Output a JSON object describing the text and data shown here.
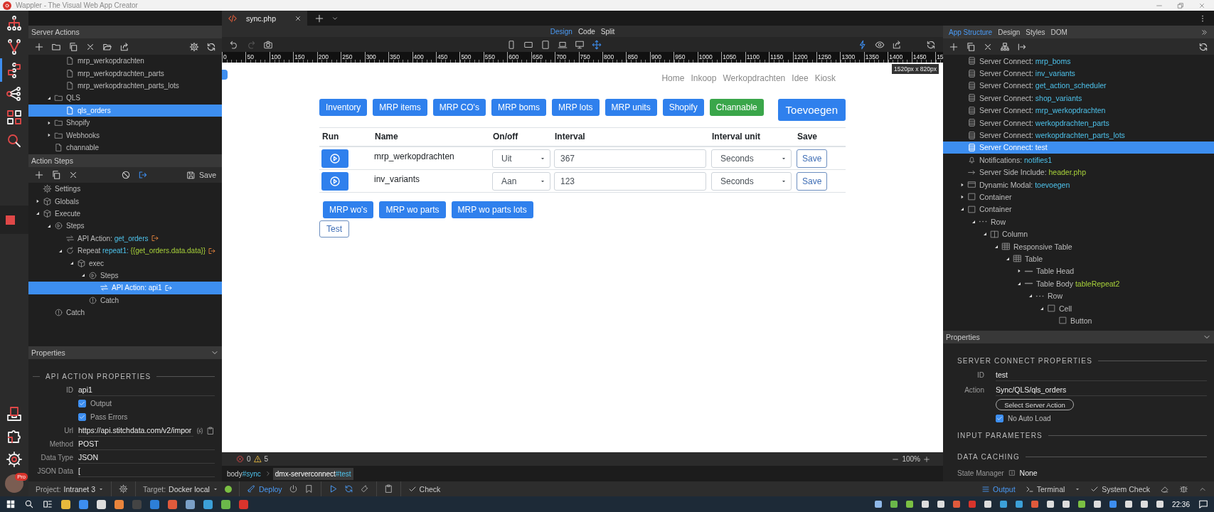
{
  "window": {
    "title": "Wappler - The Visual Web App Creator"
  },
  "rail": {
    "items": [
      {
        "kind": "structure",
        "selected": false
      },
      {
        "kind": "branch",
        "selected": false
      },
      {
        "kind": "flow",
        "selected": true
      },
      {
        "kind": "share",
        "selected": false
      },
      {
        "kind": "grid",
        "selected": false
      },
      {
        "kind": "search",
        "selected": false
      }
    ],
    "badge": "Pro"
  },
  "server_actions": {
    "title": "Server Actions",
    "tree": [
      {
        "children": [
          {
            "label": "mrp_werkopdrachten",
            "kind": "file",
            "selected": false
          },
          {
            "label": "mrp_werkopdrachten_parts",
            "kind": "file",
            "selected": false
          },
          {
            "label": "mrp_werkopdrachten_parts_lots",
            "kind": "file",
            "selected": false
          }
        ]
      },
      {
        "label": "QLS",
        "kind": "folder",
        "expanded": true,
        "selected": false,
        "children": [
          {
            "label": "qls_orders",
            "kind": "file",
            "selected": true
          }
        ]
      },
      {
        "label": "Shopify",
        "kind": "folder",
        "expanded": false,
        "selected": false
      },
      {
        "label": "Webhooks",
        "kind": "folder",
        "expanded": false,
        "selected": false
      },
      {
        "label": "channable",
        "kind": "file",
        "selected": false
      }
    ]
  },
  "action_steps": {
    "title": "Action Steps",
    "save": "Save",
    "tree": [
      {
        "label": "Settings",
        "kind": "settings",
        "selected": false,
        "output": false
      },
      {
        "label": "Globals",
        "kind": "cube",
        "expanded": false,
        "selected": false,
        "output": false
      },
      {
        "label": "Execute",
        "kind": "cube",
        "expanded": true,
        "selected": false,
        "output": false,
        "children": [
          {
            "label": "Steps",
            "kind": "steps",
            "expanded": true,
            "selected": false,
            "output": false,
            "children": [
              {
                "label": "API Action:",
                "kind": "api",
                "refs": [
                  {
                    "text": "get_orders",
                    "kind": "name"
                  }
                ],
                "selected": false,
                "output": true
              },
              {
                "label": "Repeat",
                "kind": "repeat",
                "refs": [
                  {
                    "text": "repeat1:",
                    "kind": "name"
                  },
                  {
                    "text": "{{get_orders.data.data}}",
                    "kind": "expression"
                  }
                ],
                "expanded": true,
                "selected": false,
                "output": true,
                "children": [
                  {
                    "label": "exec",
                    "kind": "cube",
                    "expanded": true,
                    "selected": false,
                    "output": false,
                    "children": [
                      {
                        "label": "Steps",
                        "kind": "steps",
                        "expanded": true,
                        "selected": false,
                        "output": false,
                        "children": [
                          {
                            "label": "API Action: api1",
                            "kind": "api",
                            "selected": true,
                            "output": true
                          }
                        ]
                      },
                      {
                        "label": "Catch",
                        "kind": "catch",
                        "selected": false,
                        "output": false
                      }
                    ]
                  }
                ]
              }
            ]
          },
          {
            "label": "Catch",
            "kind": "catch",
            "selected": false,
            "output": false
          }
        ]
      }
    ]
  },
  "action_properties": {
    "title": "Properties",
    "section": "API ACTION PROPERTIES",
    "fields": [
      {
        "kind": "text",
        "label": "ID",
        "value": "api1"
      },
      {
        "kind": "checkbox",
        "label": "Output",
        "checked": true
      },
      {
        "kind": "checkbox",
        "label": "Pass Errors",
        "checked": true
      },
      {
        "kind": "url",
        "label": "Url",
        "value": "https://api.stitchdata.com/v2/impor"
      },
      {
        "kind": "text",
        "label": "Method",
        "value": "POST"
      },
      {
        "kind": "text",
        "label": "Data Type",
        "value": "JSON"
      },
      {
        "kind": "text",
        "label": "JSON Data",
        "value": "["
      }
    ]
  },
  "editor": {
    "tabs": [
      {
        "label": "sync.php",
        "selected": true
      }
    ],
    "views": [
      {
        "label": "Design",
        "selected": true
      },
      {
        "label": "Code",
        "selected": false
      },
      {
        "label": "Split",
        "selected": false
      }
    ],
    "ruler": [
      "0",
      "50",
      "100",
      "150",
      "200",
      "250",
      "300",
      "350",
      "400",
      "450",
      "500",
      "550",
      "600",
      "650",
      "700",
      "750",
      "800",
      "850",
      "900",
      "950",
      "1000",
      "1050",
      "1100",
      "1150",
      "1200",
      "1250",
      "1300",
      "1350",
      "1400",
      "1450",
      "15"
    ],
    "size_badge": "1520px x 820px",
    "page": {
      "nav": [
        "Home",
        "Inkoop",
        "Werkopdrachten",
        "Idee",
        "Kiosk"
      ],
      "buttons": [
        {
          "label": "Inventory",
          "kind": "primary"
        },
        {
          "label": "MRP items",
          "kind": "primary"
        },
        {
          "label": "MRP CO's",
          "kind": "primary"
        },
        {
          "label": "MRP boms",
          "kind": "primary"
        },
        {
          "label": "MRP lots",
          "kind": "primary"
        },
        {
          "label": "MRP units",
          "kind": "primary"
        },
        {
          "label": "Shopify",
          "kind": "primary"
        },
        {
          "label": "Channable",
          "kind": "success"
        }
      ],
      "add_button": "Toevoegen",
      "table": {
        "columns": [
          "Run",
          "Name",
          "On/off",
          "Interval",
          "Interval unit",
          "Save"
        ],
        "rows": [
          {
            "name": "mrp_werkopdrachten",
            "on_off": "Uit",
            "interval": "367",
            "unit": "Seconds",
            "save": "Save"
          },
          {
            "name": "inv_variants",
            "on_off": "Aan",
            "interval": "123",
            "unit": "Seconds",
            "save": "Save"
          }
        ]
      },
      "buttons_2": [
        {
          "label": "MRP wo's",
          "kind": "primary"
        },
        {
          "label": "MRP wo parts",
          "kind": "primary"
        },
        {
          "label": "MRP wo parts lots",
          "kind": "primary"
        }
      ],
      "test_button": "Test"
    },
    "errors": "0",
    "warnings": "5",
    "zoom": "100%",
    "breadcrumb": [
      {
        "tag": "body",
        "id": "#sync",
        "selected": false
      },
      {
        "tag": "dmx-serverconnect",
        "id": "#test",
        "selected": true
      }
    ]
  },
  "structure": {
    "tabs": [
      {
        "label": "App Structure",
        "selected": true
      },
      {
        "label": "Design",
        "selected": false
      },
      {
        "label": "Styles",
        "selected": false
      },
      {
        "label": "DOM",
        "selected": false
      }
    ],
    "tree": [
      {
        "label": "Server Connect:",
        "kind": "db",
        "refs": [
          {
            "text": "mrp_boms",
            "kind": "name"
          }
        ],
        "selected": false
      },
      {
        "label": "Server Connect:",
        "kind": "db",
        "refs": [
          {
            "text": "inv_variants",
            "kind": "name"
          }
        ],
        "selected": false
      },
      {
        "label": "Server Connect:",
        "kind": "db",
        "refs": [
          {
            "text": "get_action_scheduler",
            "kind": "name"
          }
        ],
        "selected": false
      },
      {
        "label": "Server Connect:",
        "kind": "db",
        "refs": [
          {
            "text": "shop_variants",
            "kind": "name"
          }
        ],
        "selected": false
      },
      {
        "label": "Server Connect:",
        "kind": "db",
        "refs": [
          {
            "text": "mrp_werkopdrachten",
            "kind": "name"
          }
        ],
        "selected": false
      },
      {
        "label": "Server Connect:",
        "kind": "db",
        "refs": [
          {
            "text": "werkopdrachten_parts",
            "kind": "name"
          }
        ],
        "selected": false
      },
      {
        "label": "Server Connect:",
        "kind": "db",
        "refs": [
          {
            "text": "werkopdrachten_parts_lots",
            "kind": "name"
          }
        ],
        "selected": false
      },
      {
        "label": "Server Connect: test",
        "kind": "db",
        "selected": true
      },
      {
        "label": "Notifications:",
        "kind": "notify",
        "refs": [
          {
            "text": "notifies1",
            "kind": "name"
          }
        ],
        "selected": false
      },
      {
        "label": "Server Side Include:",
        "kind": "include",
        "refs": [
          {
            "text": "header.php",
            "kind": "expression"
          }
        ],
        "selected": false
      },
      {
        "label": "Dynamic Modal:",
        "kind": "modal",
        "refs": [
          {
            "text": "toevoegen",
            "kind": "name"
          }
        ],
        "expanded": false,
        "selected": false
      },
      {
        "label": "Container",
        "kind": "box",
        "expanded": false,
        "selected": false
      },
      {
        "label": "Container",
        "kind": "box",
        "expanded": true,
        "selected": false,
        "children": [
          {
            "label": "Row",
            "kind": "row",
            "expanded": true,
            "selected": false,
            "children": [
              {
                "label": "Column",
                "kind": "column",
                "expanded": true,
                "selected": false,
                "children": [
                  {
                    "label": "Responsive Table",
                    "kind": "table",
                    "expanded": true,
                    "selected": false,
                    "children": [
                      {
                        "label": "Table",
                        "kind": "table",
                        "expanded": true,
                        "selected": false,
                        "children": [
                          {
                            "label": "Table Head",
                            "kind": "dash",
                            "expanded": false,
                            "selected": false
                          },
                          {
                            "label": "Table Body",
                            "kind": "dash",
                            "refs": [
                              {
                                "text": "tableRepeat2",
                                "kind": "expression"
                              }
                            ],
                            "expanded": true,
                            "selected": false,
                            "children": [
                              {
                                "label": "Row",
                                "kind": "row",
                                "expanded": true,
                                "selected": false,
                                "children": [
                                  {
                                    "label": "Cell",
                                    "kind": "box",
                                    "expanded": true,
                                    "selected": false,
                                    "children": [
                                      {
                                        "label": "Button",
                                        "kind": "box",
                                        "selected": false
                                      }
                                    ]
                                  }
                                ]
                              }
                            ]
                          }
                        ]
                      }
                    ]
                  }
                ]
              }
            ]
          }
        ]
      }
    ]
  },
  "connect_properties": {
    "title": "Properties",
    "section": "SERVER CONNECT PROPERTIES",
    "id_label": "ID",
    "id": "test",
    "action_label": "Action",
    "action": "Sync/QLS/qls_orders",
    "select_button": "Select Server Action",
    "no_auto_load": {
      "label": "No Auto Load",
      "checked": true
    },
    "sections": [
      "INPUT PARAMETERS",
      "DATA CACHING"
    ],
    "state_manager": {
      "label": "State Manager",
      "value": "None"
    }
  },
  "status_bar": {
    "project_label": "Project:",
    "project": "Intranet 3",
    "target_label": "Target:",
    "target": "Docker local",
    "target_online": true,
    "deploy": "Deploy",
    "check": "Check",
    "panels": [
      {
        "label": "Output",
        "kind": "output",
        "selected": true
      },
      {
        "label": "Terminal",
        "kind": "terminal",
        "selected": false
      }
    ],
    "system_check": "System Check"
  },
  "taskbar": {
    "time": "22:36"
  }
}
